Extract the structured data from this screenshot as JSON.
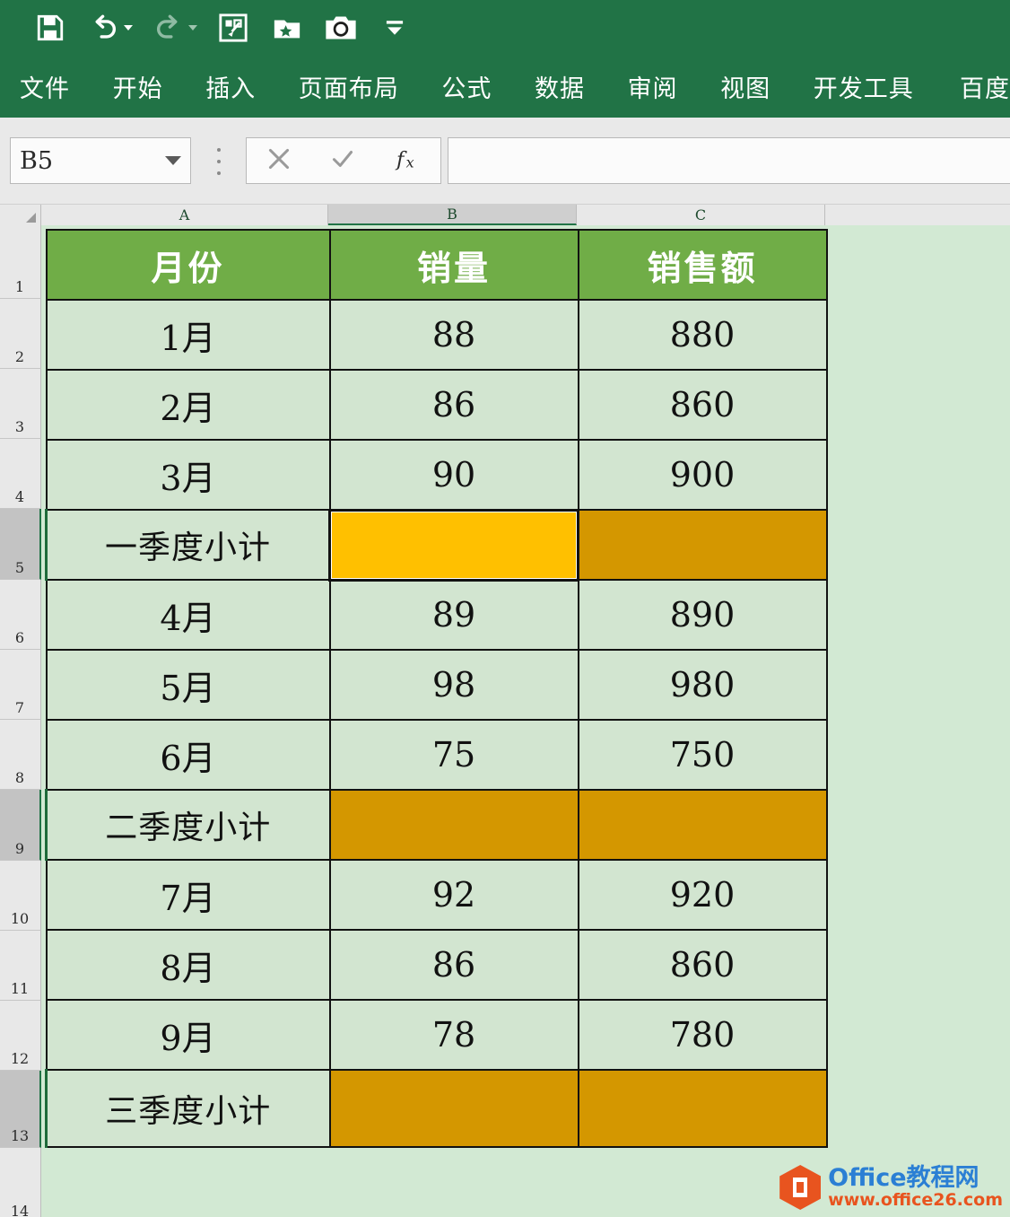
{
  "app": {
    "ribbon_color": "#217346",
    "quick_access": [
      {
        "name": "save-icon",
        "label": "保存"
      },
      {
        "name": "undo-icon",
        "label": "撤销",
        "has_caret": true
      },
      {
        "name": "redo-icon",
        "label": "恢复",
        "has_caret": true,
        "disabled": true
      },
      {
        "name": "table-tool-icon",
        "label": "表格工具"
      },
      {
        "name": "favorites-folder-icon",
        "label": "收藏夹"
      },
      {
        "name": "camera-screenshot-icon",
        "label": "截图"
      },
      {
        "name": "customize-toolbar-icon",
        "label": "自定义快速访问工具栏"
      }
    ],
    "tabs": [
      {
        "label": "文件"
      },
      {
        "label": "开始"
      },
      {
        "label": "插入"
      },
      {
        "label": "页面布局"
      },
      {
        "label": "公式"
      },
      {
        "label": "数据"
      },
      {
        "label": "审阅"
      },
      {
        "label": "视图"
      },
      {
        "label": "开发工具"
      },
      {
        "label": "百度"
      }
    ]
  },
  "formula_bar": {
    "name_box_value": "B5",
    "name_box_placeholder": "名称框",
    "cancel_label": "取消",
    "enter_label": "输入",
    "function_label": "插入函数",
    "formula_value": "",
    "formula_placeholder": "编辑栏"
  },
  "grid": {
    "column_headers": [
      "A",
      "B",
      "C"
    ],
    "selected_column": "B",
    "row_headers": [
      "1",
      "2",
      "3",
      "4",
      "5",
      "6",
      "7",
      "8",
      "9",
      "10",
      "11",
      "12",
      "13",
      "14"
    ],
    "selected_rows": [
      "5",
      "9",
      "13"
    ],
    "header_fill": "#70AD47",
    "cell_fill": "#D2E5D0",
    "active_cell_fill": "#FFC000",
    "subtotal_fill": "#D49700"
  },
  "table": {
    "headers": [
      "月份",
      "销量",
      "销售额"
    ],
    "rows": [
      {
        "row": "2",
        "type": "data",
        "month": "1月",
        "qty": "88",
        "amount": "880"
      },
      {
        "row": "3",
        "type": "data",
        "month": "2月",
        "qty": "86",
        "amount": "860"
      },
      {
        "row": "4",
        "type": "data",
        "month": "3月",
        "qty": "90",
        "amount": "900"
      },
      {
        "row": "5",
        "type": "subtotal",
        "month": "一季度小计",
        "qty": "",
        "amount": "",
        "active": "B"
      },
      {
        "row": "6",
        "type": "data",
        "month": "4月",
        "qty": "89",
        "amount": "890"
      },
      {
        "row": "7",
        "type": "data",
        "month": "5月",
        "qty": "98",
        "amount": "980"
      },
      {
        "row": "8",
        "type": "data",
        "month": "6月",
        "qty": "75",
        "amount": "750"
      },
      {
        "row": "9",
        "type": "subtotal",
        "month": "二季度小计",
        "qty": "",
        "amount": ""
      },
      {
        "row": "10",
        "type": "data",
        "month": "7月",
        "qty": "92",
        "amount": "920"
      },
      {
        "row": "11",
        "type": "data",
        "month": "8月",
        "qty": "86",
        "amount": "860"
      },
      {
        "row": "12",
        "type": "data",
        "month": "9月",
        "qty": "78",
        "amount": "780"
      },
      {
        "row": "13",
        "type": "subtotal",
        "month": "三季度小计",
        "qty": "",
        "amount": ""
      }
    ]
  },
  "watermark": {
    "title": "Office教程网",
    "url": "www.office26.com",
    "title_color": "#2B7FD4",
    "url_color": "#E8541F"
  }
}
